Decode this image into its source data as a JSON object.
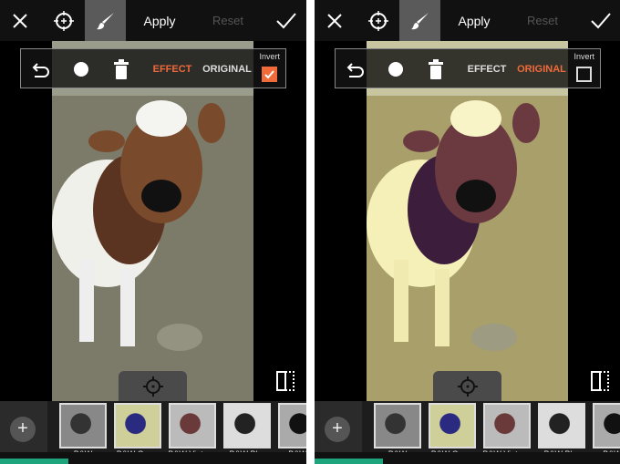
{
  "panels": [
    {
      "apply": "Apply",
      "reset": "Reset",
      "effect": "EFFECT",
      "original": "ORIGINAL",
      "invert": "Invert",
      "invert_checked": true,
      "active_mode": "effect",
      "filters": [
        {
          "label": "B&W"
        },
        {
          "label": "B&W Cross"
        },
        {
          "label": "B&W Vintage"
        },
        {
          "label": "B&W Blur"
        },
        {
          "label": "B&W H"
        }
      ]
    },
    {
      "apply": "Apply",
      "reset": "Reset",
      "effect": "EFFECT",
      "original": "ORIGINAL",
      "invert": "Invert",
      "invert_checked": false,
      "active_mode": "original",
      "filters": [
        {
          "label": "B&W"
        },
        {
          "label": "B&W Cross"
        },
        {
          "label": "B&W Vintage"
        },
        {
          "label": "B&W Blur"
        },
        {
          "label": "B&W H"
        }
      ]
    }
  ],
  "colors": {
    "accent": "#f06a3a",
    "active_tool": "#5a5a5a"
  },
  "icons": [
    "close-icon",
    "target-icon",
    "brush-icon",
    "check-icon",
    "undo-icon",
    "brush-size-icon",
    "trash-icon",
    "settings-icon",
    "compare-icon",
    "plus-icon"
  ]
}
